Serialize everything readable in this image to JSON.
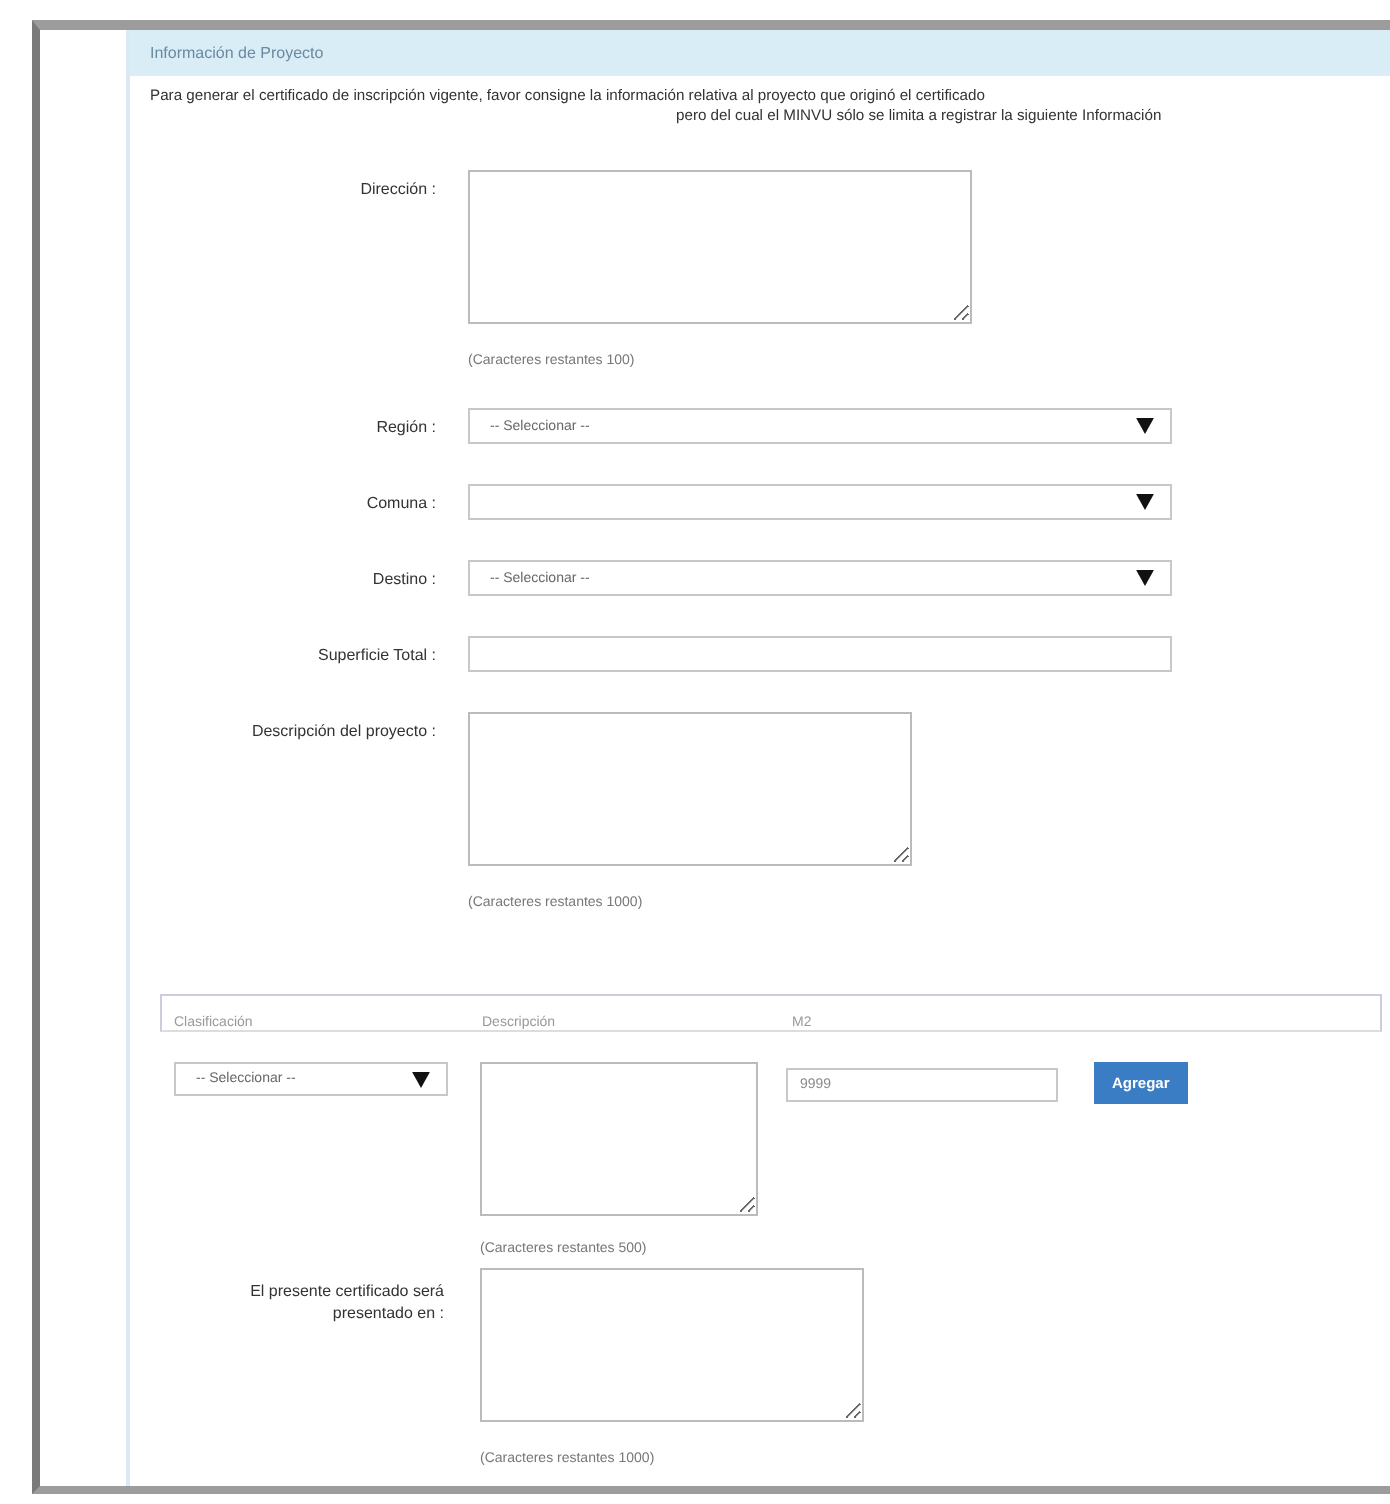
{
  "panel": {
    "title": "Información de Proyecto",
    "intro": [
      "Para generar el certificado de inscripción vigente, favor consigne la información relativa al proyecto que originó el certificado",
      "pero del cual el MINVU sólo se limita a registrar la siguiente Información"
    ],
    "fields": [
      {
        "kind": "textarea",
        "label": "Dirección :",
        "hint": "(Caracteres restantes 100)"
      },
      {
        "kind": "select",
        "label": "Región :",
        "value": "-- Seleccionar --"
      },
      {
        "kind": "select",
        "label": "Comuna :"
      },
      {
        "kind": "select",
        "label": "Destino :",
        "value": "-- Seleccionar --"
      },
      {
        "kind": "input",
        "label": "Superficie Total :"
      },
      {
        "kind": "textarea",
        "label": "Descripción del proyecto :",
        "hint": "(Caracteres restantes 1000)"
      }
    ],
    "table": {
      "columns": [
        "Clasificación",
        "Descripción",
        "M2"
      ],
      "row": {
        "clasificacion": "-- Seleccionar --",
        "descripcion_hint": "(Caracteres restantes 500)",
        "m2_placeholder": "9999",
        "button": "Agregar"
      }
    },
    "fields_after": [
      {
        "kind": "textarea",
        "label": "El presente certificado será presentado en :",
        "hint": "(Caracteres restantes 1000)"
      }
    ]
  }
}
